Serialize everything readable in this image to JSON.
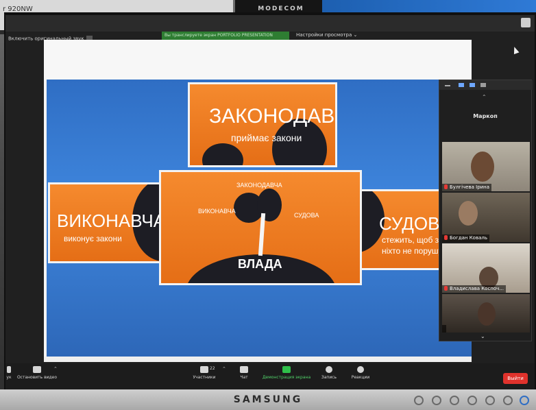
{
  "environment": {
    "background_monitor_model": "r 920NW",
    "accessory_brand": "MODECOM",
    "monitor_brand": "SAMSUNG"
  },
  "zoom": {
    "original_sound_label": "Включить оригинальный звук",
    "sharing_banner": "Вы транслируете экран PORTFOLIO PRESENTATION",
    "view_options_label": "Настройки просмотра",
    "view_options_caret": "⌄"
  },
  "slide": {
    "cards": {
      "legislative": {
        "title": "ЗАКОНОДАВЧА",
        "subtitle": "приймає закони"
      },
      "executive": {
        "title": "ВИКОНАВЧА",
        "subtitle": "виконує закони"
      },
      "judicial": {
        "title": "СУДОВА",
        "subtitle_line1": "стежить, щоб зак",
        "subtitle_line2": "ніхто не порушува"
      },
      "center": {
        "title": "ВЛАДА",
        "label_top": "ЗАКОНОДАВЧА",
        "label_left": "ВИКОНАВЧА",
        "label_right": "СУДОВА"
      }
    }
  },
  "participants_panel": {
    "host_name": "Маркоп",
    "tiles": [
      {
        "name": "Булгічева Ірина"
      },
      {
        "name": "Богдан Коваль"
      },
      {
        "name": "Владислава Коспоч..."
      },
      {
        "name": ""
      }
    ]
  },
  "toolbar": {
    "left_partial_label": "ук",
    "stop_video": "Остановить видео",
    "participants": "Участники",
    "participants_count": "22",
    "chat": "Чат",
    "share_screen": "Демонстрация экрана",
    "record": "Запись",
    "reactions": "Реакции",
    "leave": "Выйти"
  },
  "colors": {
    "slide_orange": "#f07a22",
    "slide_blue": "#3f86dd",
    "share_green": "#2fbf4a",
    "leave_red": "#e0322c",
    "sharing_bar_green": "#2e7d32"
  }
}
